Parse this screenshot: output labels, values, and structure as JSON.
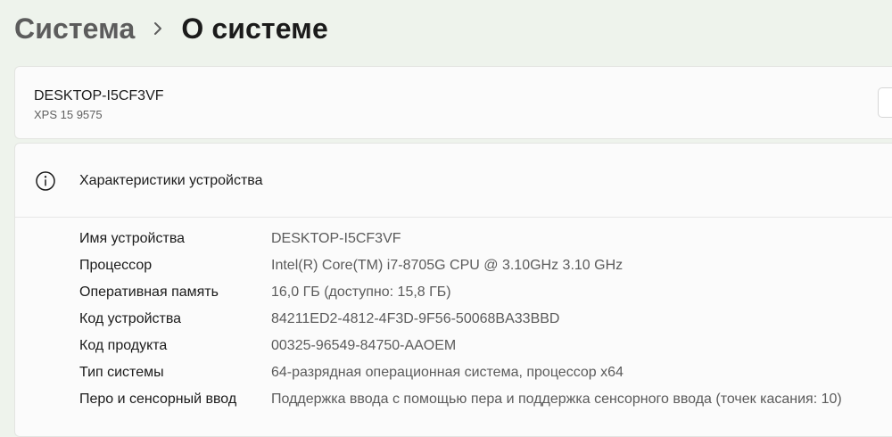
{
  "breadcrumb": {
    "parent": "Система",
    "current": "О системе"
  },
  "device": {
    "name": "DESKTOP-I5CF3VF",
    "model": "XPS 15 9575"
  },
  "specs": {
    "title": "Характеристики устройства",
    "icon": "info-icon",
    "rows": [
      {
        "label": "Имя устройства",
        "value": "DESKTOP-I5CF3VF"
      },
      {
        "label": "Процессор",
        "value": "Intel(R) Core(TM) i7-8705G CPU @ 3.10GHz   3.10 GHz"
      },
      {
        "label": "Оперативная память",
        "value": "16,0 ГБ (доступно: 15,8 ГБ)"
      },
      {
        "label": "Код устройства",
        "value": "84211ED2-4812-4F3D-9F56-50068BA33BBD"
      },
      {
        "label": "Код продукта",
        "value": "00325-96549-84750-AAOEM"
      },
      {
        "label": "Тип системы",
        "value": "64-разрядная операционная система, процессор x64"
      },
      {
        "label": "Перо и сенсорный ввод",
        "value": "Поддержка ввода с помощью пера и поддержка сенсорного ввода (точек касания: 10)"
      }
    ]
  },
  "colors": {
    "background": "#eef3ec",
    "card": "#fbfbfb",
    "primary_text": "#1b1b1b",
    "secondary_text": "#5b5b5b"
  }
}
